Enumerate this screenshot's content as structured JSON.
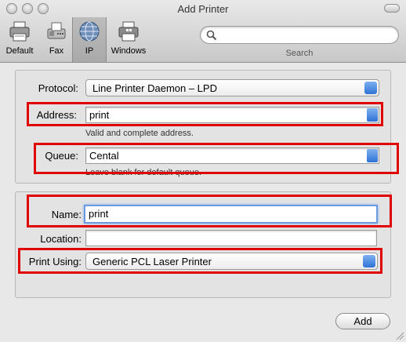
{
  "window": {
    "title": "Add Printer"
  },
  "toolbar": {
    "items": [
      {
        "label": "Default",
        "icon": "printer-icon"
      },
      {
        "label": "Fax",
        "icon": "fax-icon"
      },
      {
        "label": "IP",
        "icon": "globe-icon",
        "selected": true
      },
      {
        "label": "Windows",
        "icon": "windows-printer-icon"
      }
    ],
    "search": {
      "label": "Search",
      "value": ""
    }
  },
  "form": {
    "protocol": {
      "label": "Protocol:",
      "value": "Line Printer Daemon – LPD"
    },
    "address": {
      "label": "Address:",
      "value": "print",
      "hint": "Valid and complete address."
    },
    "queue": {
      "label": "Queue:",
      "value": "Cental",
      "hint": "Leave blank for default queue."
    },
    "name": {
      "label": "Name:",
      "value": "print"
    },
    "location": {
      "label": "Location:",
      "value": ""
    },
    "print_using": {
      "label": "Print Using:",
      "value": "Generic PCL Laser Printer"
    }
  },
  "buttons": {
    "add": "Add"
  },
  "colors": {
    "highlight": "#e00000",
    "focus_ring": "#6d9be0",
    "accent_blue": "#2f73d6"
  }
}
